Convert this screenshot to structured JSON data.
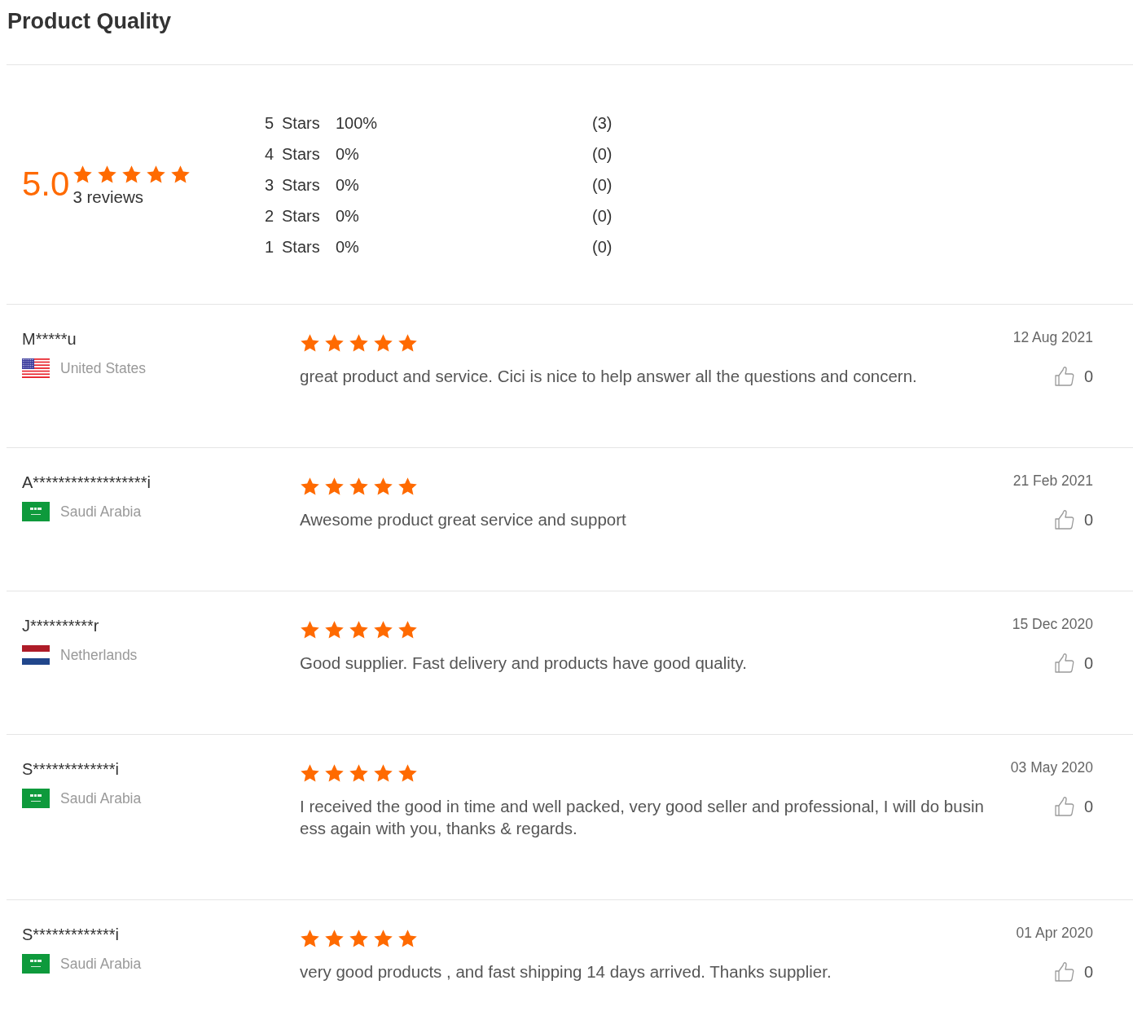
{
  "title": "Product Quality",
  "summary": {
    "score": "5.0",
    "stars": 5,
    "reviews_count": "3 reviews",
    "breakdown": [
      {
        "rank": "5",
        "label": "Stars",
        "percent": "100%",
        "count": "(3)"
      },
      {
        "rank": "4",
        "label": "Stars",
        "percent": "0%",
        "count": "(0)"
      },
      {
        "rank": "3",
        "label": "Stars",
        "percent": "0%",
        "count": "(0)"
      },
      {
        "rank": "2",
        "label": "Stars",
        "percent": "0%",
        "count": "(0)"
      },
      {
        "rank": "1",
        "label": "Stars",
        "percent": "0%",
        "count": "(0)"
      }
    ]
  },
  "reviews": [
    {
      "name": "M*****u",
      "kind": "us",
      "country": "United States",
      "stars": 5,
      "text": "great product and service. Cici is nice to help answer all the questions and concern.",
      "date": "12 Aug 2021",
      "likes": "0"
    },
    {
      "name": "A******************i",
      "kind": "sa",
      "country": "Saudi Arabia",
      "stars": 5,
      "text": "Awesome product great service and support",
      "date": "21 Feb 2021",
      "likes": "0"
    },
    {
      "name": "J**********r",
      "kind": "nl",
      "country": "Netherlands",
      "stars": 5,
      "text": "Good supplier. Fast delivery and products have good quality.",
      "date": "15 Dec 2020",
      "likes": "0"
    },
    {
      "name": "S*************i",
      "kind": "sa",
      "country": "Saudi Arabia",
      "stars": 5,
      "text": "I received the good in time and well packed, very good seller and professional, I will do business again with you, thanks & regards.",
      "date": "03 May 2020",
      "likes": "0"
    },
    {
      "name": "S*************i",
      "kind": "sa",
      "country": "Saudi Arabia",
      "stars": 5,
      "text": "very good products , and fast shipping 14 days arrived. Thanks supplier.",
      "date": "01 Apr 2020",
      "likes": "0"
    }
  ]
}
